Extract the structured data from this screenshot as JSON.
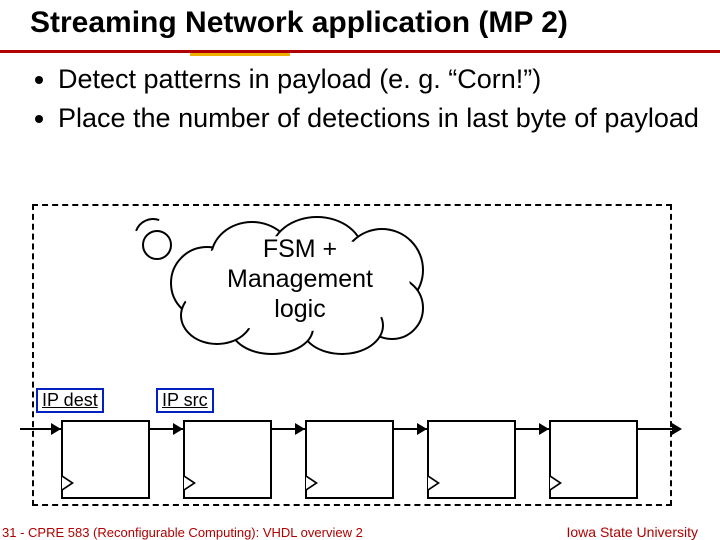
{
  "title": "Streaming Network application (MP 2)",
  "bullets": {
    "b1": "Detect patterns in payload (e. g. “Corn!”)",
    "b2": "Place the number of detections in last byte of payload"
  },
  "cloud": {
    "line1": "FSM +",
    "line2": "Management",
    "line3": "logic"
  },
  "labels": {
    "ip_dest": "IP dest",
    "ip_src": "IP src"
  },
  "footer": {
    "left": "31 - CPRE 583 (Reconfigurable Computing): VHDL overview 2",
    "right": "Iowa State University"
  }
}
